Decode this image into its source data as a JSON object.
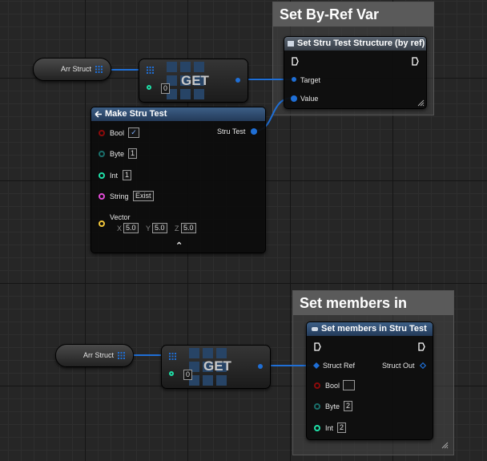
{
  "comment_top": {
    "title": "Set By-Ref Var"
  },
  "comment_bottom": {
    "title": "Set members in"
  },
  "top": {
    "arr_struct_label": "Arr Struct",
    "get_label": "GET",
    "get_index": "0",
    "set_node": {
      "title": "Set Stru Test Structure (by ref)",
      "target_label": "Target",
      "value_label": "Value"
    },
    "make_node": {
      "title": "Make Stru Test",
      "output_label": "Stru Test",
      "bool_label": "Bool",
      "bool_value": "✓",
      "byte_label": "Byte",
      "byte_value": "1",
      "int_label": "Int",
      "int_value": "1",
      "string_label": "String",
      "string_value": "Exist",
      "vector_label": "Vector",
      "x_label": "X",
      "x_value": "5.0",
      "y_label": "Y",
      "y_value": "5.0",
      "z_label": "Z",
      "z_value": "5.0",
      "collapse_glyph": "⌃"
    }
  },
  "bottom": {
    "arr_struct_label": "Arr Struct",
    "get_label": "GET",
    "get_index": "0",
    "set_members_node": {
      "title": "Set members in Stru Test",
      "struct_ref_label": "Struct Ref",
      "struct_out_label": "Struct Out",
      "bool_label": "Bool",
      "byte_label": "Byte",
      "byte_value": "2",
      "int_label": "Int",
      "int_value": "2"
    }
  },
  "colors": {
    "struct_pin": "#1f6fd6",
    "bool_pin": "#8c0b0b",
    "byte_pin": "#1a6e6a",
    "int_pin": "#1fe0a8",
    "string_pin": "#e24bd7",
    "vector_pin": "#f0c53a",
    "exec_pin": "#ffffff"
  },
  "icons": {
    "array": "array-grid-icon",
    "exec": "exec-arrow-icon",
    "struct": "struct-icon",
    "resize": "resize-grip-icon",
    "function": "function-icon"
  }
}
